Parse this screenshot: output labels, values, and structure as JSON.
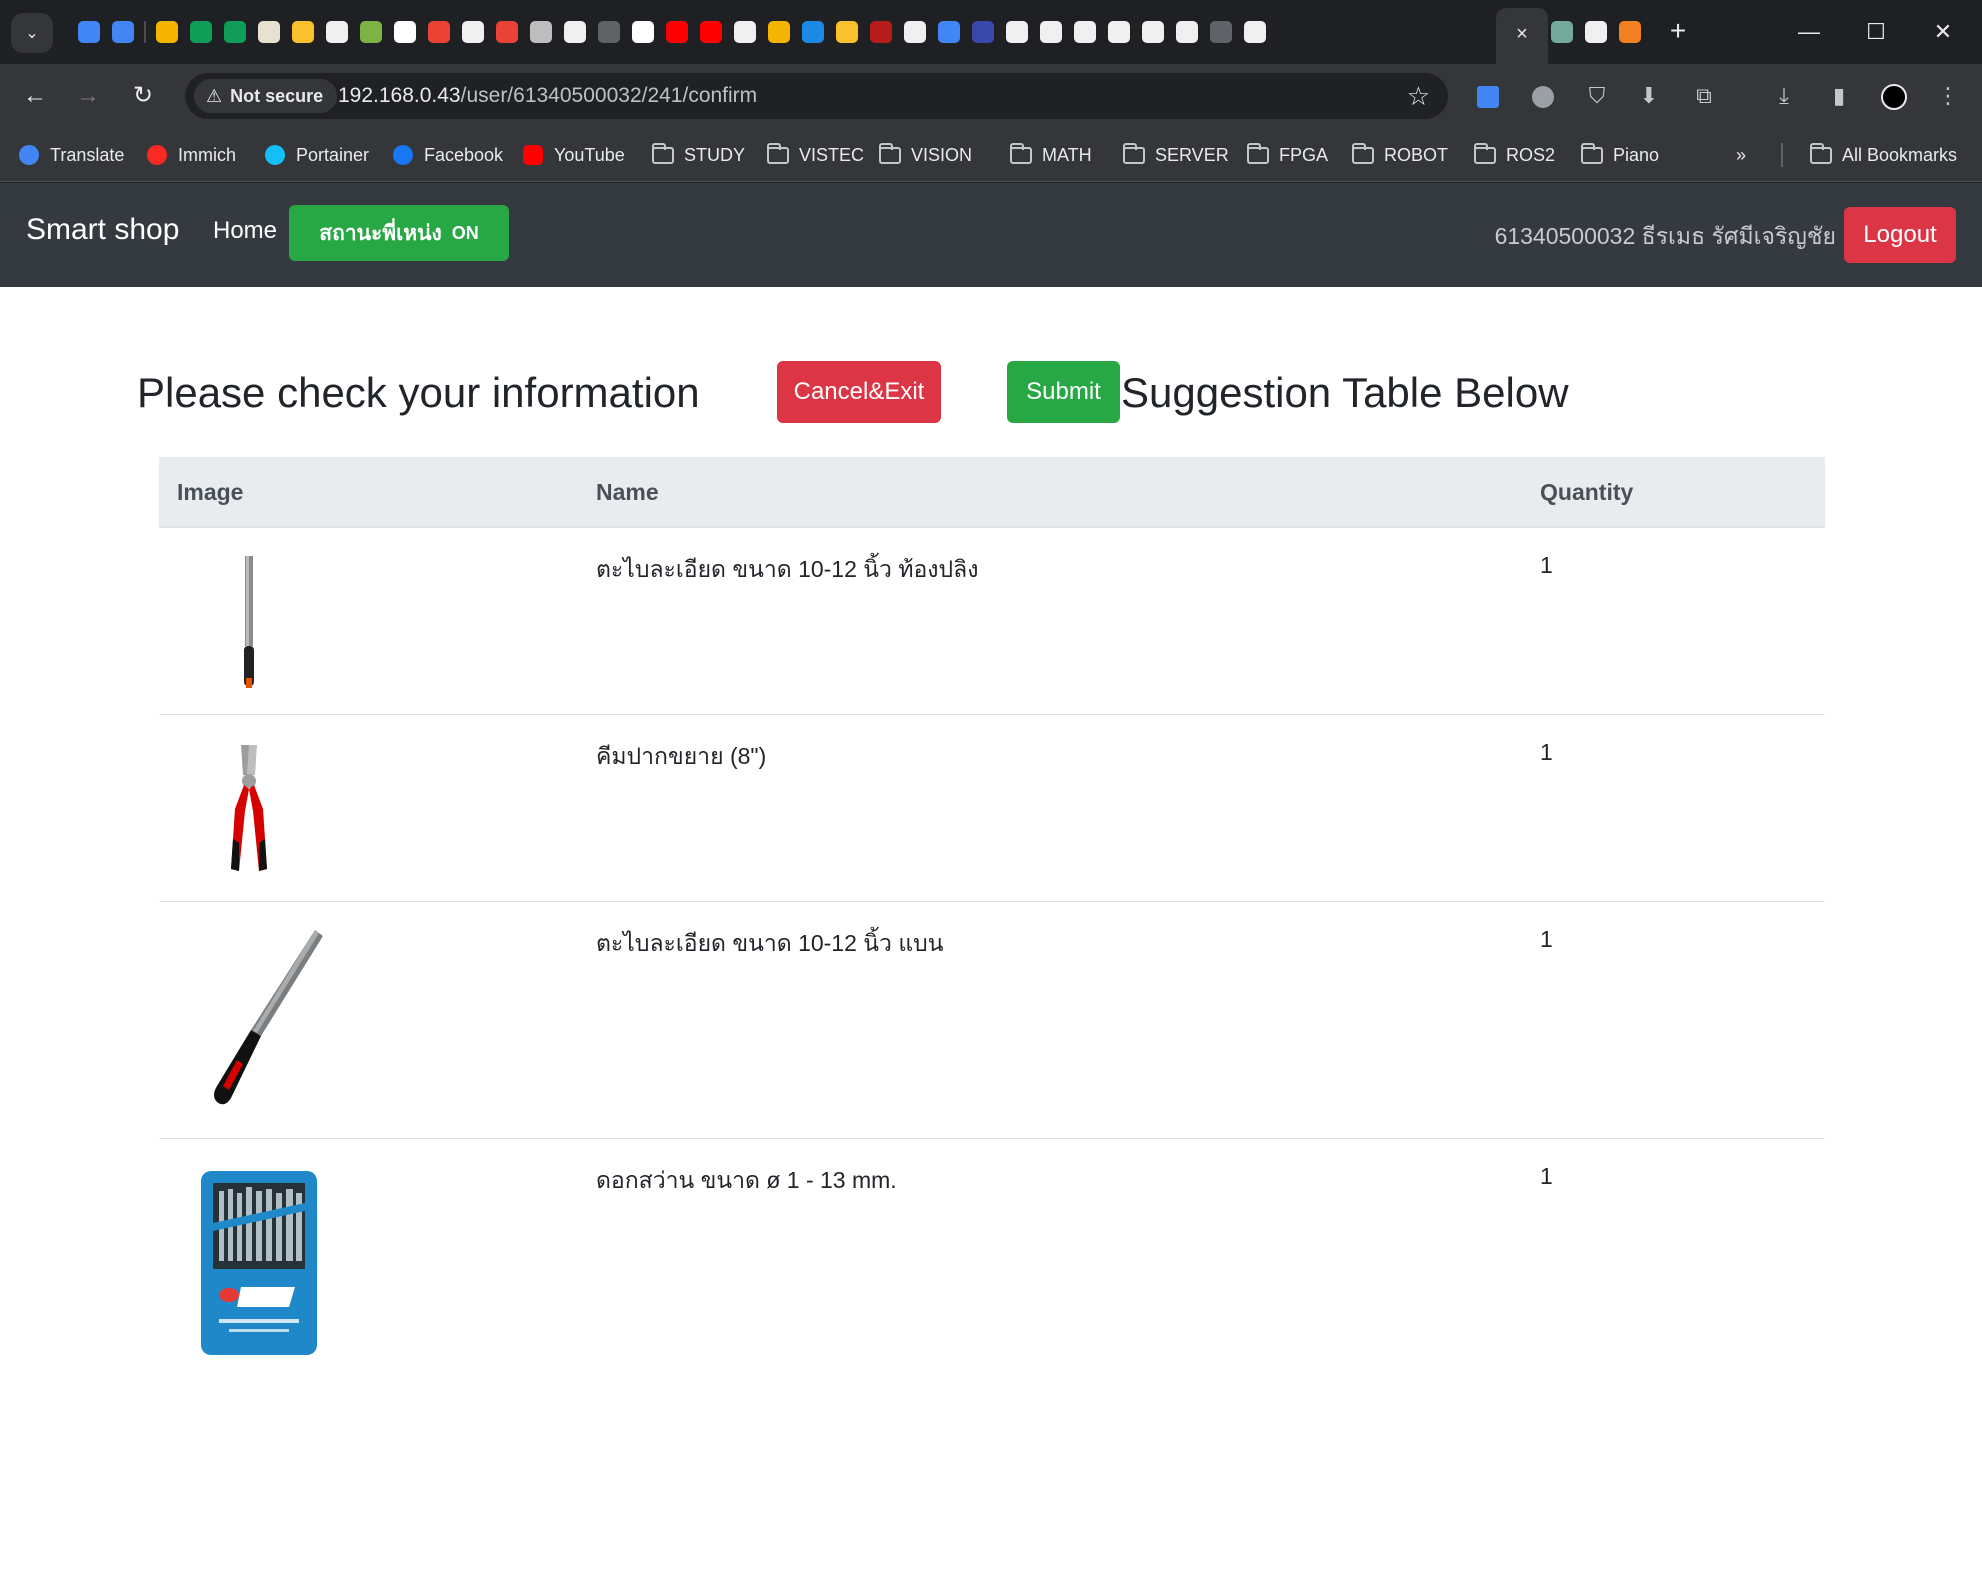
{
  "browser": {
    "tab_search_icon": "chevron-down-icon",
    "tab_favicon_colors": [
      "#4285f4",
      "#4285f4",
      "sep",
      "#f4b400",
      "#0f9d58",
      "#0f9d58",
      "#e8e0d0",
      "#fbc02d",
      "#f0f0f0",
      "#7cb342",
      "#ffffff",
      "#ea4335",
      "#f0f0f0",
      "#ea4335",
      "#bdbdbd",
      "#f0f0f0",
      "#5f6368",
      "#ffffff",
      "#ff0000",
      "#ff0000",
      "#f0f0f0",
      "#f4b400",
      "#1e88e5",
      "#fbc02d",
      "#b71c1c",
      "#f0f0f0",
      "#4285f4",
      "#3949ab",
      "#f0f0f0",
      "#f0f0f0",
      "#f0f0f0",
      "#f0f0f0",
      "#f0f0f0",
      "#f0f0f0",
      "#5f6368",
      "#f0f0f0",
      "#f0f0f0",
      "#f48024",
      "#4fc3f7",
      "#f0f0f0"
    ],
    "trailing_favicon_colors": [
      "#74aa9c",
      "#f0f0f0",
      "#f48024"
    ],
    "security_label": "Not secure",
    "url_host": "192.168.0.43",
    "url_path": "/user/61340500032/241/confirm",
    "bookmarks": [
      {
        "label": "Translate",
        "icon": "translate-icon",
        "color": "#4285f4"
      },
      {
        "label": "Immich",
        "icon": "immich-icon",
        "color": "#fa2921"
      },
      {
        "label": "Portainer",
        "icon": "portainer-icon",
        "color": "#13bef9"
      },
      {
        "label": "Facebook",
        "icon": "facebook-icon",
        "color": "#1877f2"
      },
      {
        "label": "YouTube",
        "icon": "youtube-icon",
        "color": "#ff0000"
      },
      {
        "label": "STUDY",
        "icon": "folder-icon"
      },
      {
        "label": "VISTEC",
        "icon": "folder-icon"
      },
      {
        "label": "VISION",
        "icon": "folder-icon"
      },
      {
        "label": "MATH",
        "icon": "folder-icon"
      },
      {
        "label": "SERVER",
        "icon": "folder-icon"
      },
      {
        "label": "FPGA",
        "icon": "folder-icon"
      },
      {
        "label": "ROBOT",
        "icon": "folder-icon"
      },
      {
        "label": "ROS2",
        "icon": "folder-icon"
      },
      {
        "label": "Piano",
        "icon": "folder-icon"
      }
    ],
    "more_bookmarks": "»",
    "all_bookmarks": "All Bookmarks"
  },
  "navbar": {
    "brand": "Smart shop",
    "home": "Home",
    "status_label": "สถานะพี่เหน่ง",
    "status_value": "ON",
    "user": "61340500032 ธีรเมธ รัศมีเจริญชัย",
    "logout": "Logout"
  },
  "page": {
    "title": "Please check your information",
    "cancel": "Cancel&Exit",
    "submit": "Submit",
    "suggestion_title": "Suggestion Table Below"
  },
  "table": {
    "headers": {
      "image": "Image",
      "name": "Name",
      "quantity": "Quantity"
    },
    "rows": [
      {
        "image": "half-round-file-image",
        "name": "ตะไบละเอียด ขนาด 10-12 นิ้ว ท้องปลิง",
        "quantity": "1"
      },
      {
        "image": "pliers-image",
        "name": "คีมปากขยาย (8\")",
        "quantity": "1"
      },
      {
        "image": "flat-file-image",
        "name": "ตะไบละเอียด ขนาด 10-12 นิ้ว แบน",
        "quantity": "1"
      },
      {
        "image": "drill-bit-set-image",
        "name": "ดอกสว่าน ขนาด ø 1 - 13 mm.",
        "quantity": "1"
      }
    ]
  },
  "colors": {
    "navbar_bg": "#343a40",
    "success": "#28a745",
    "danger": "#dc3545",
    "table_head_bg": "#e9ecef"
  }
}
